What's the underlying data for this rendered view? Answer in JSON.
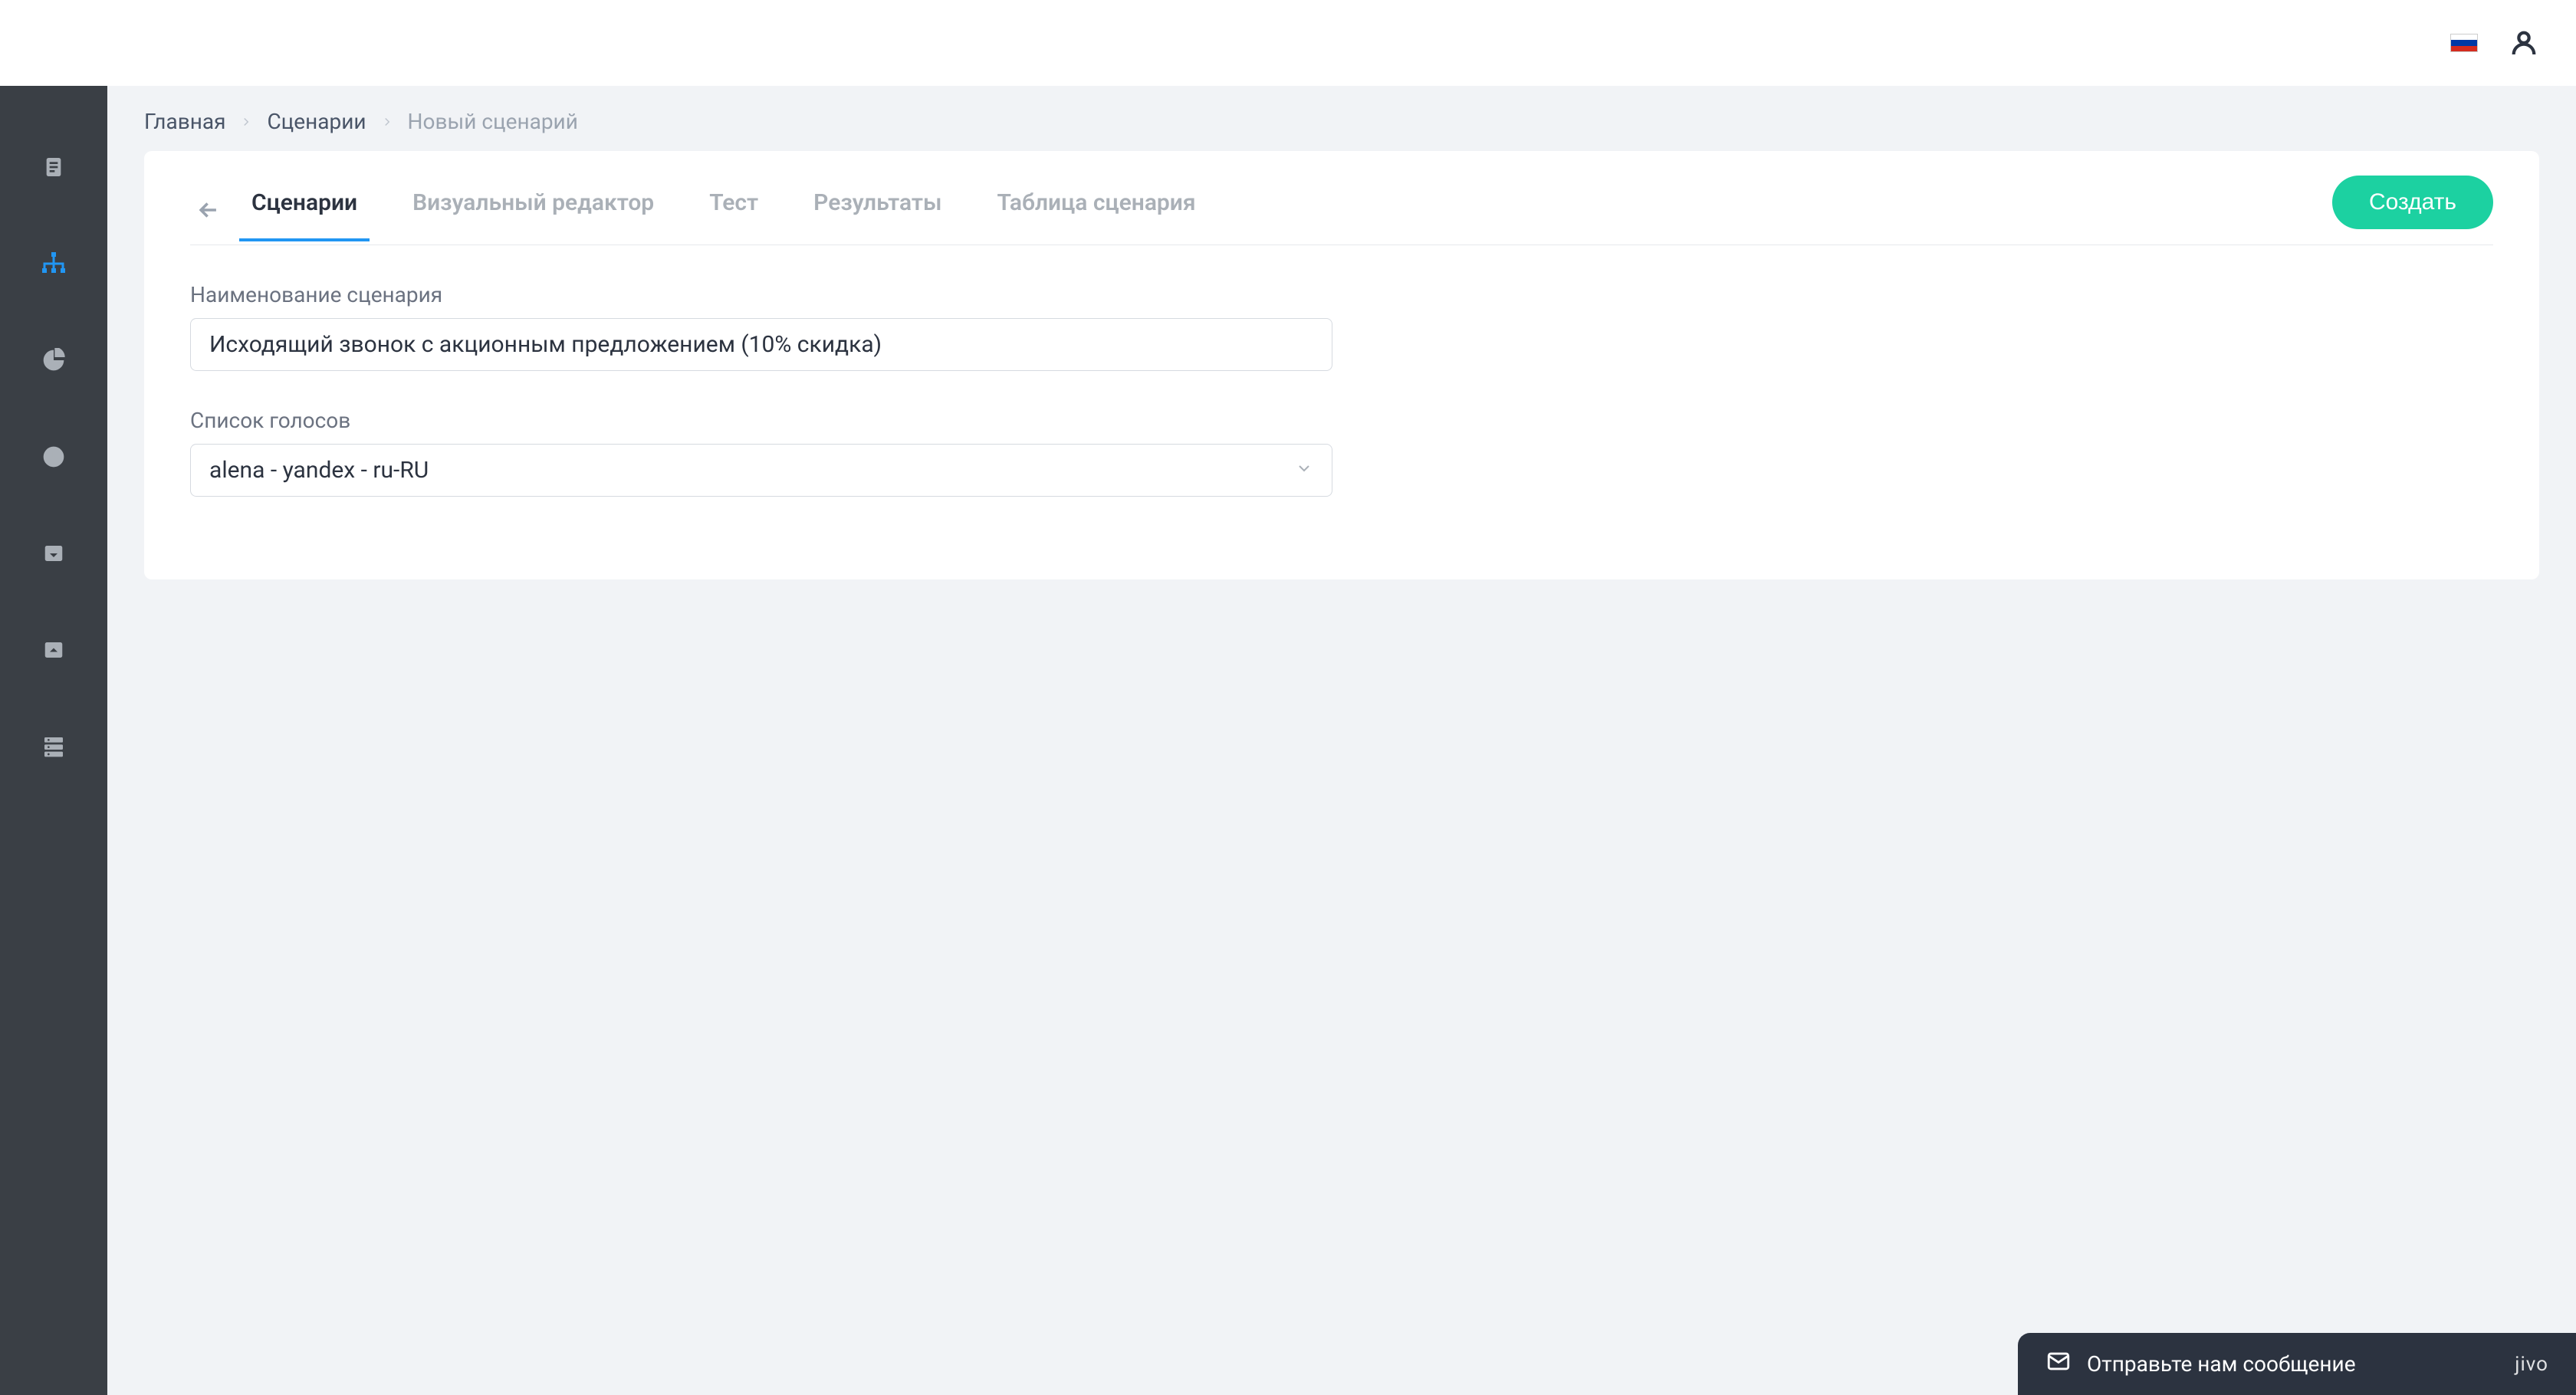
{
  "topbar": {
    "flag": "ru"
  },
  "breadcrumb": {
    "home": "Главная",
    "scenarios": "Сценарии",
    "current": "Новый сценарий"
  },
  "tabs": {
    "scenarios": "Сценарии",
    "visual_editor": "Визуальный редактор",
    "test": "Тест",
    "results": "Результаты",
    "table": "Таблица сценария"
  },
  "actions": {
    "create": "Создать"
  },
  "form": {
    "name_label": "Наименование сценария",
    "name_value": "Исходящий звонок с акционным предложением (10% скидка)",
    "voices_label": "Список голосов",
    "voices_value": "alena - yandex - ru-RU"
  },
  "chat": {
    "text": "Отправьте нам сообщение",
    "brand": "jivo"
  }
}
